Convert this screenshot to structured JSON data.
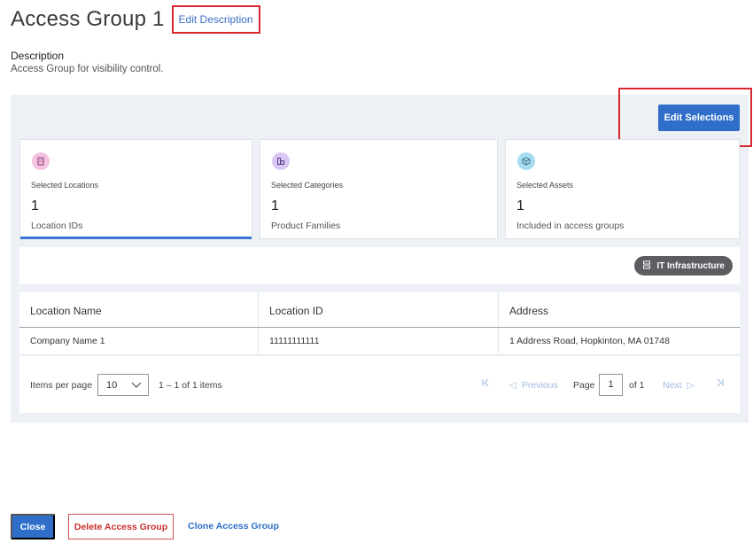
{
  "header": {
    "title": "Access Group 1",
    "edit_description": "Edit Description"
  },
  "description": {
    "label": "Description",
    "text": "Access Group for visibility control."
  },
  "toolbar": {
    "edit_selections": "Edit Selections"
  },
  "cards": [
    {
      "label": "Selected Locations",
      "count": "1",
      "sub": "Location IDs",
      "icon": "building-icon",
      "active": true
    },
    {
      "label": "Selected Categories",
      "count": "1",
      "sub": "Product Families",
      "icon": "category-icon",
      "active": false
    },
    {
      "label": "Selected Assets",
      "count": "1",
      "sub": "Included in access groups",
      "icon": "cube-icon",
      "active": false
    }
  ],
  "chip": {
    "label": "IT Infrastructure",
    "icon": "server-icon"
  },
  "table": {
    "columns": [
      "Location Name",
      "Location ID",
      "Address"
    ],
    "rows": [
      [
        "Company Name 1",
        "11111111111",
        "1 Address Road, Hopkinton, MA 01748"
      ]
    ]
  },
  "pagination": {
    "items_per_page_label": "Items per page",
    "items_per_page_value": "10",
    "range": "1 – 1 of 1 items",
    "previous": "Previous",
    "page_label": "Page",
    "page_value": "1",
    "of_label": "of 1",
    "next": "Next"
  },
  "footer": {
    "close": "Close",
    "delete": "Delete Access Group",
    "clone": "Clone Access Group"
  },
  "colors": {
    "primary": "#2f6fca",
    "danger": "#c9302c",
    "panel_bg": "#edf0f4",
    "highlight_frame": "#d9272e"
  }
}
